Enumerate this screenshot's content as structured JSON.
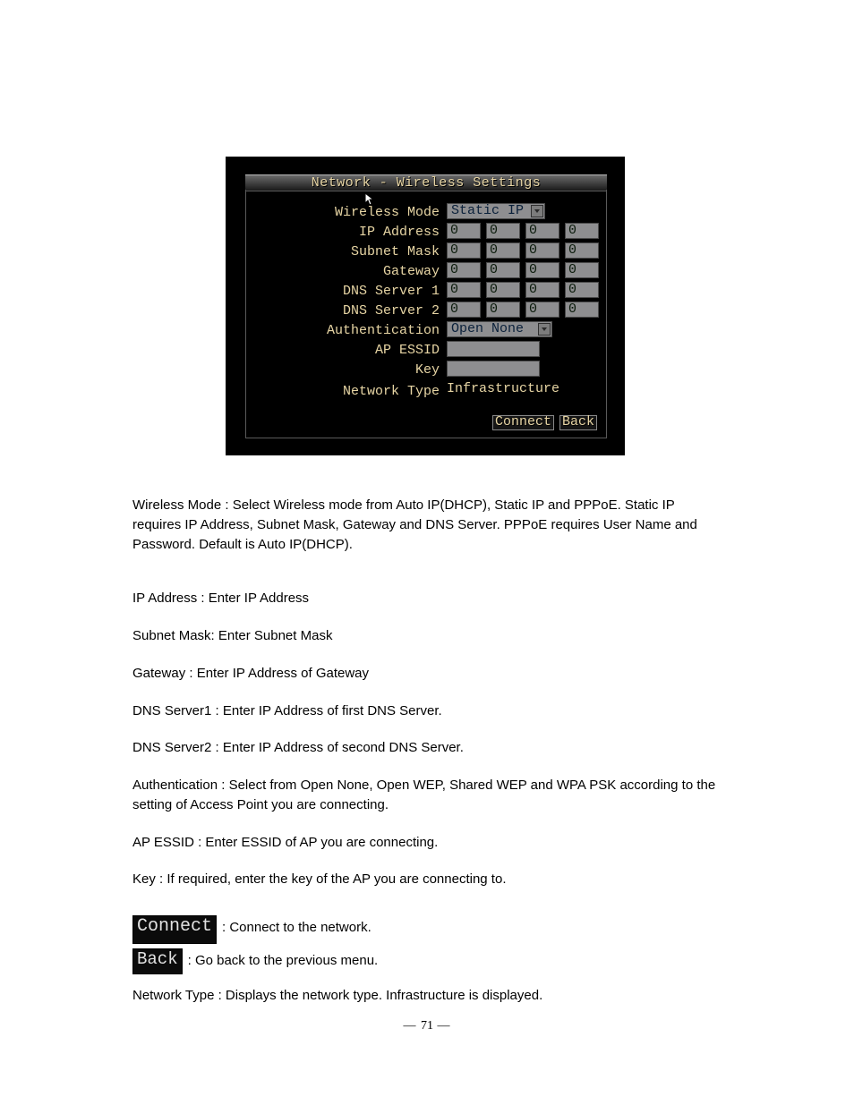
{
  "screenshot": {
    "title": "Network - Wireless Settings",
    "labels": {
      "wireless_mode": "Wireless Mode",
      "ip_address": "IP Address",
      "subnet_mask": "Subnet Mask",
      "gateway": "Gateway",
      "dns1": "DNS Server 1",
      "dns2": "DNS Server 2",
      "authentication": "Authentication",
      "ap_essid": "AP ESSID",
      "key": "Key",
      "network_type": "Network Type"
    },
    "values": {
      "wireless_mode": "Static IP",
      "ip_address": [
        "0",
        "0",
        "0",
        "0"
      ],
      "subnet_mask": [
        "0",
        "0",
        "0",
        "0"
      ],
      "gateway": [
        "0",
        "0",
        "0",
        "0"
      ],
      "dns1": [
        "0",
        "0",
        "0",
        "0"
      ],
      "dns2": [
        "0",
        "0",
        "0",
        "0"
      ],
      "authentication": "Open None",
      "ap_essid": "",
      "key": "",
      "network_type": "Infrastructure"
    },
    "buttons": {
      "connect": "Connect",
      "back": "Back"
    }
  },
  "body": {
    "p1": "Wireless Mode : Select Wireless mode from Auto IP(DHCP), Static IP and PPPoE. Static IP requires IP Address, Subnet Mask, Gateway and DNS Server. PPPoE requires User Name and Password. Default is Auto IP(DHCP).",
    "p2": "IP Address : Enter IP Address",
    "p3": "Subnet Mask: Enter Subnet Mask",
    "p4": "Gateway : Enter IP Address of Gateway",
    "p5": "DNS Server1 : Enter IP Address of first DNS Server.",
    "p6": "DNS Server2 : Enter IP Address of second DNS Server.",
    "p7": "Authentication : Select from Open None, Open WEP, Shared WEP and WPA PSK according to the setting of Access Point you are connecting.",
    "p8": "AP ESSID : Enter ESSID of AP you are connecting.",
    "p9": "Key : If required, enter the key of the AP you are connecting to.",
    "p10": "Network Type : Displays the network type. Infrastructure is displayed.",
    "connect_btn": "Connect",
    "connect_desc": " : Connect to the network.",
    "back_btn": "Back",
    "back_desc": " : Go back to the previous menu."
  },
  "page_number": "71"
}
